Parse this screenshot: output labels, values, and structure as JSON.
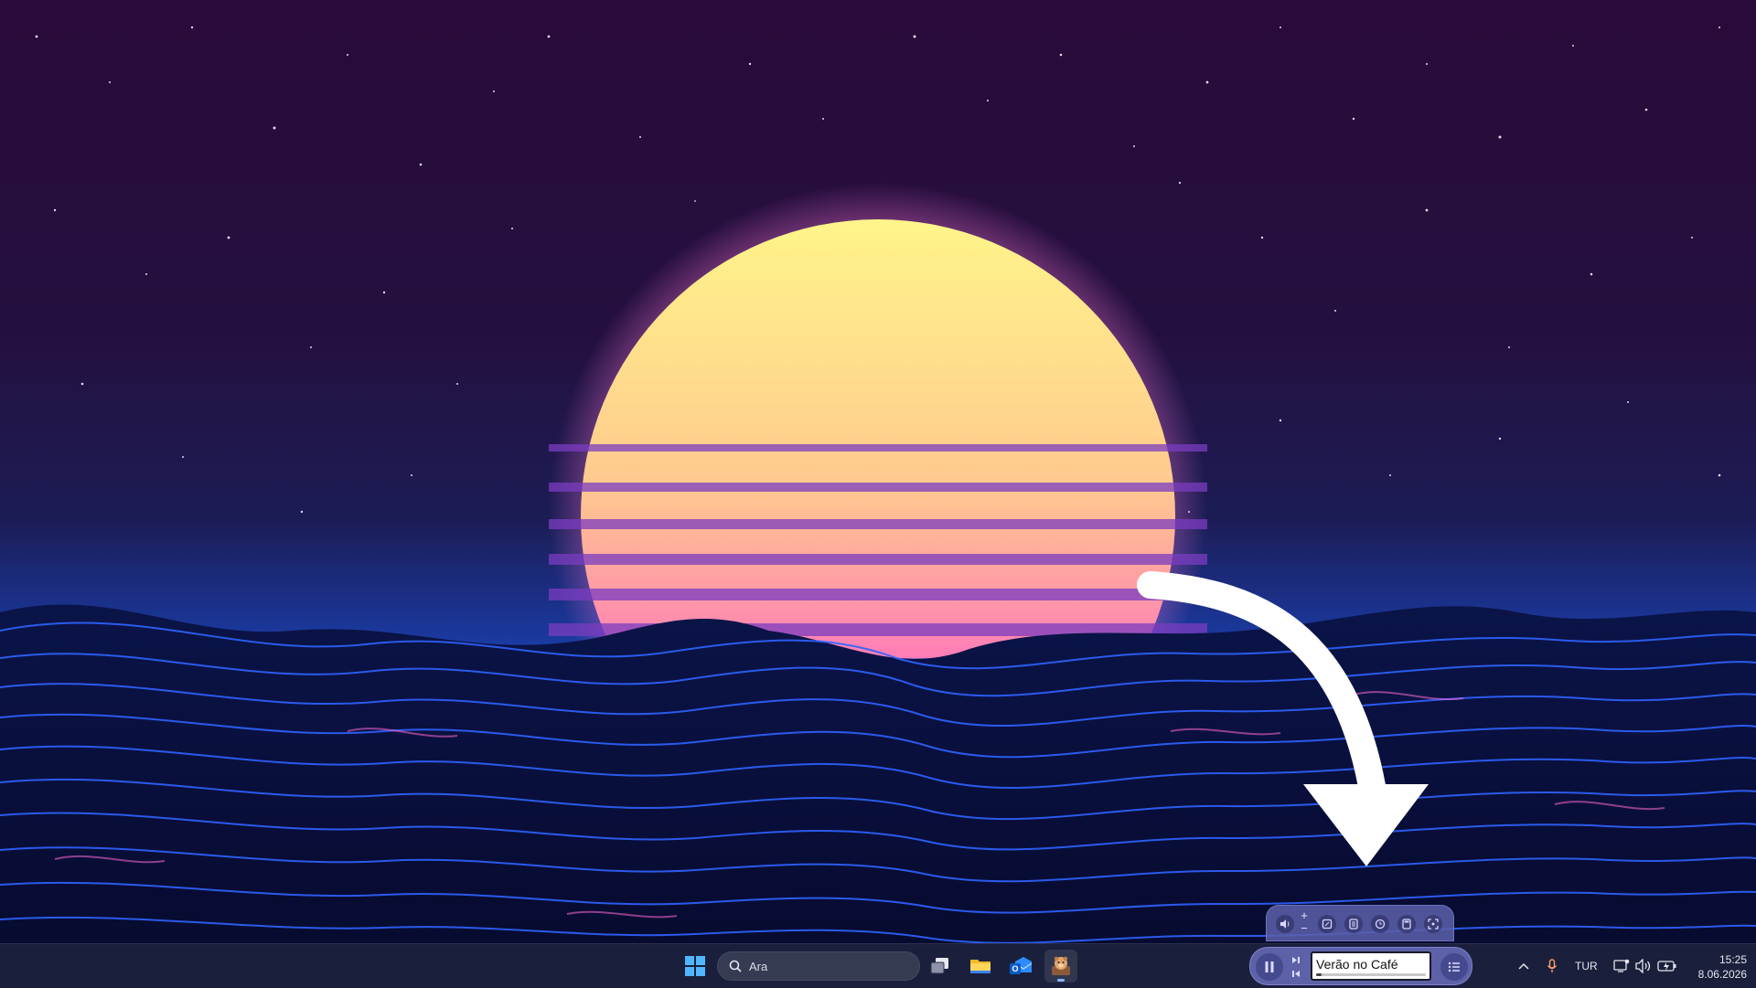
{
  "wallpaper": {
    "description_icon": "synthwave-sunset-wallpaper",
    "sun_colors": [
      "#fff48a",
      "#ffb98a",
      "#ff7ab8",
      "#ff3fae"
    ],
    "sky_colors": [
      "#2a0a3a",
      "#1c1442",
      "#1a3a9a"
    ],
    "wave_colors": [
      "#0a0f3a",
      "#2f5cff",
      "#ff6ad5"
    ],
    "arrow_color": "#ffffff"
  },
  "taskbar": {
    "search": {
      "placeholder": "Ara",
      "icon": "search-icon"
    },
    "apps": [
      {
        "name": "start-button",
        "icon": "windows-logo-icon"
      },
      {
        "name": "task-view",
        "icon": "task-view-icon"
      },
      {
        "name": "file-explorer",
        "icon": "folder-icon"
      },
      {
        "name": "outlook",
        "icon": "outlook-icon"
      },
      {
        "name": "media-app",
        "icon": "hamster-app-icon",
        "active": true
      }
    ]
  },
  "media_widget": {
    "toolbar_icons": [
      "volume-icon",
      "plus-icon",
      "minus-icon",
      "note-icon",
      "list-doc-icon",
      "timer-icon",
      "calculator-icon",
      "screenshot-icon"
    ],
    "controls": {
      "play_pause_icon": "pause-icon",
      "next_icon": "skip-next-icon",
      "prev_icon": "skip-prev-icon",
      "playlist_icon": "playlist-icon"
    },
    "track": {
      "title": "Verão no Café",
      "progress": 0.05
    }
  },
  "tray": {
    "overflow_icon": "chevron-up-icon",
    "mic_icon": "microphone-icon",
    "language": "TUR",
    "network_icon": "network-icon",
    "volume_icon": "speaker-icon",
    "battery_icon": "battery-charging-icon",
    "time": "15:25",
    "date": "8.06.2026"
  }
}
